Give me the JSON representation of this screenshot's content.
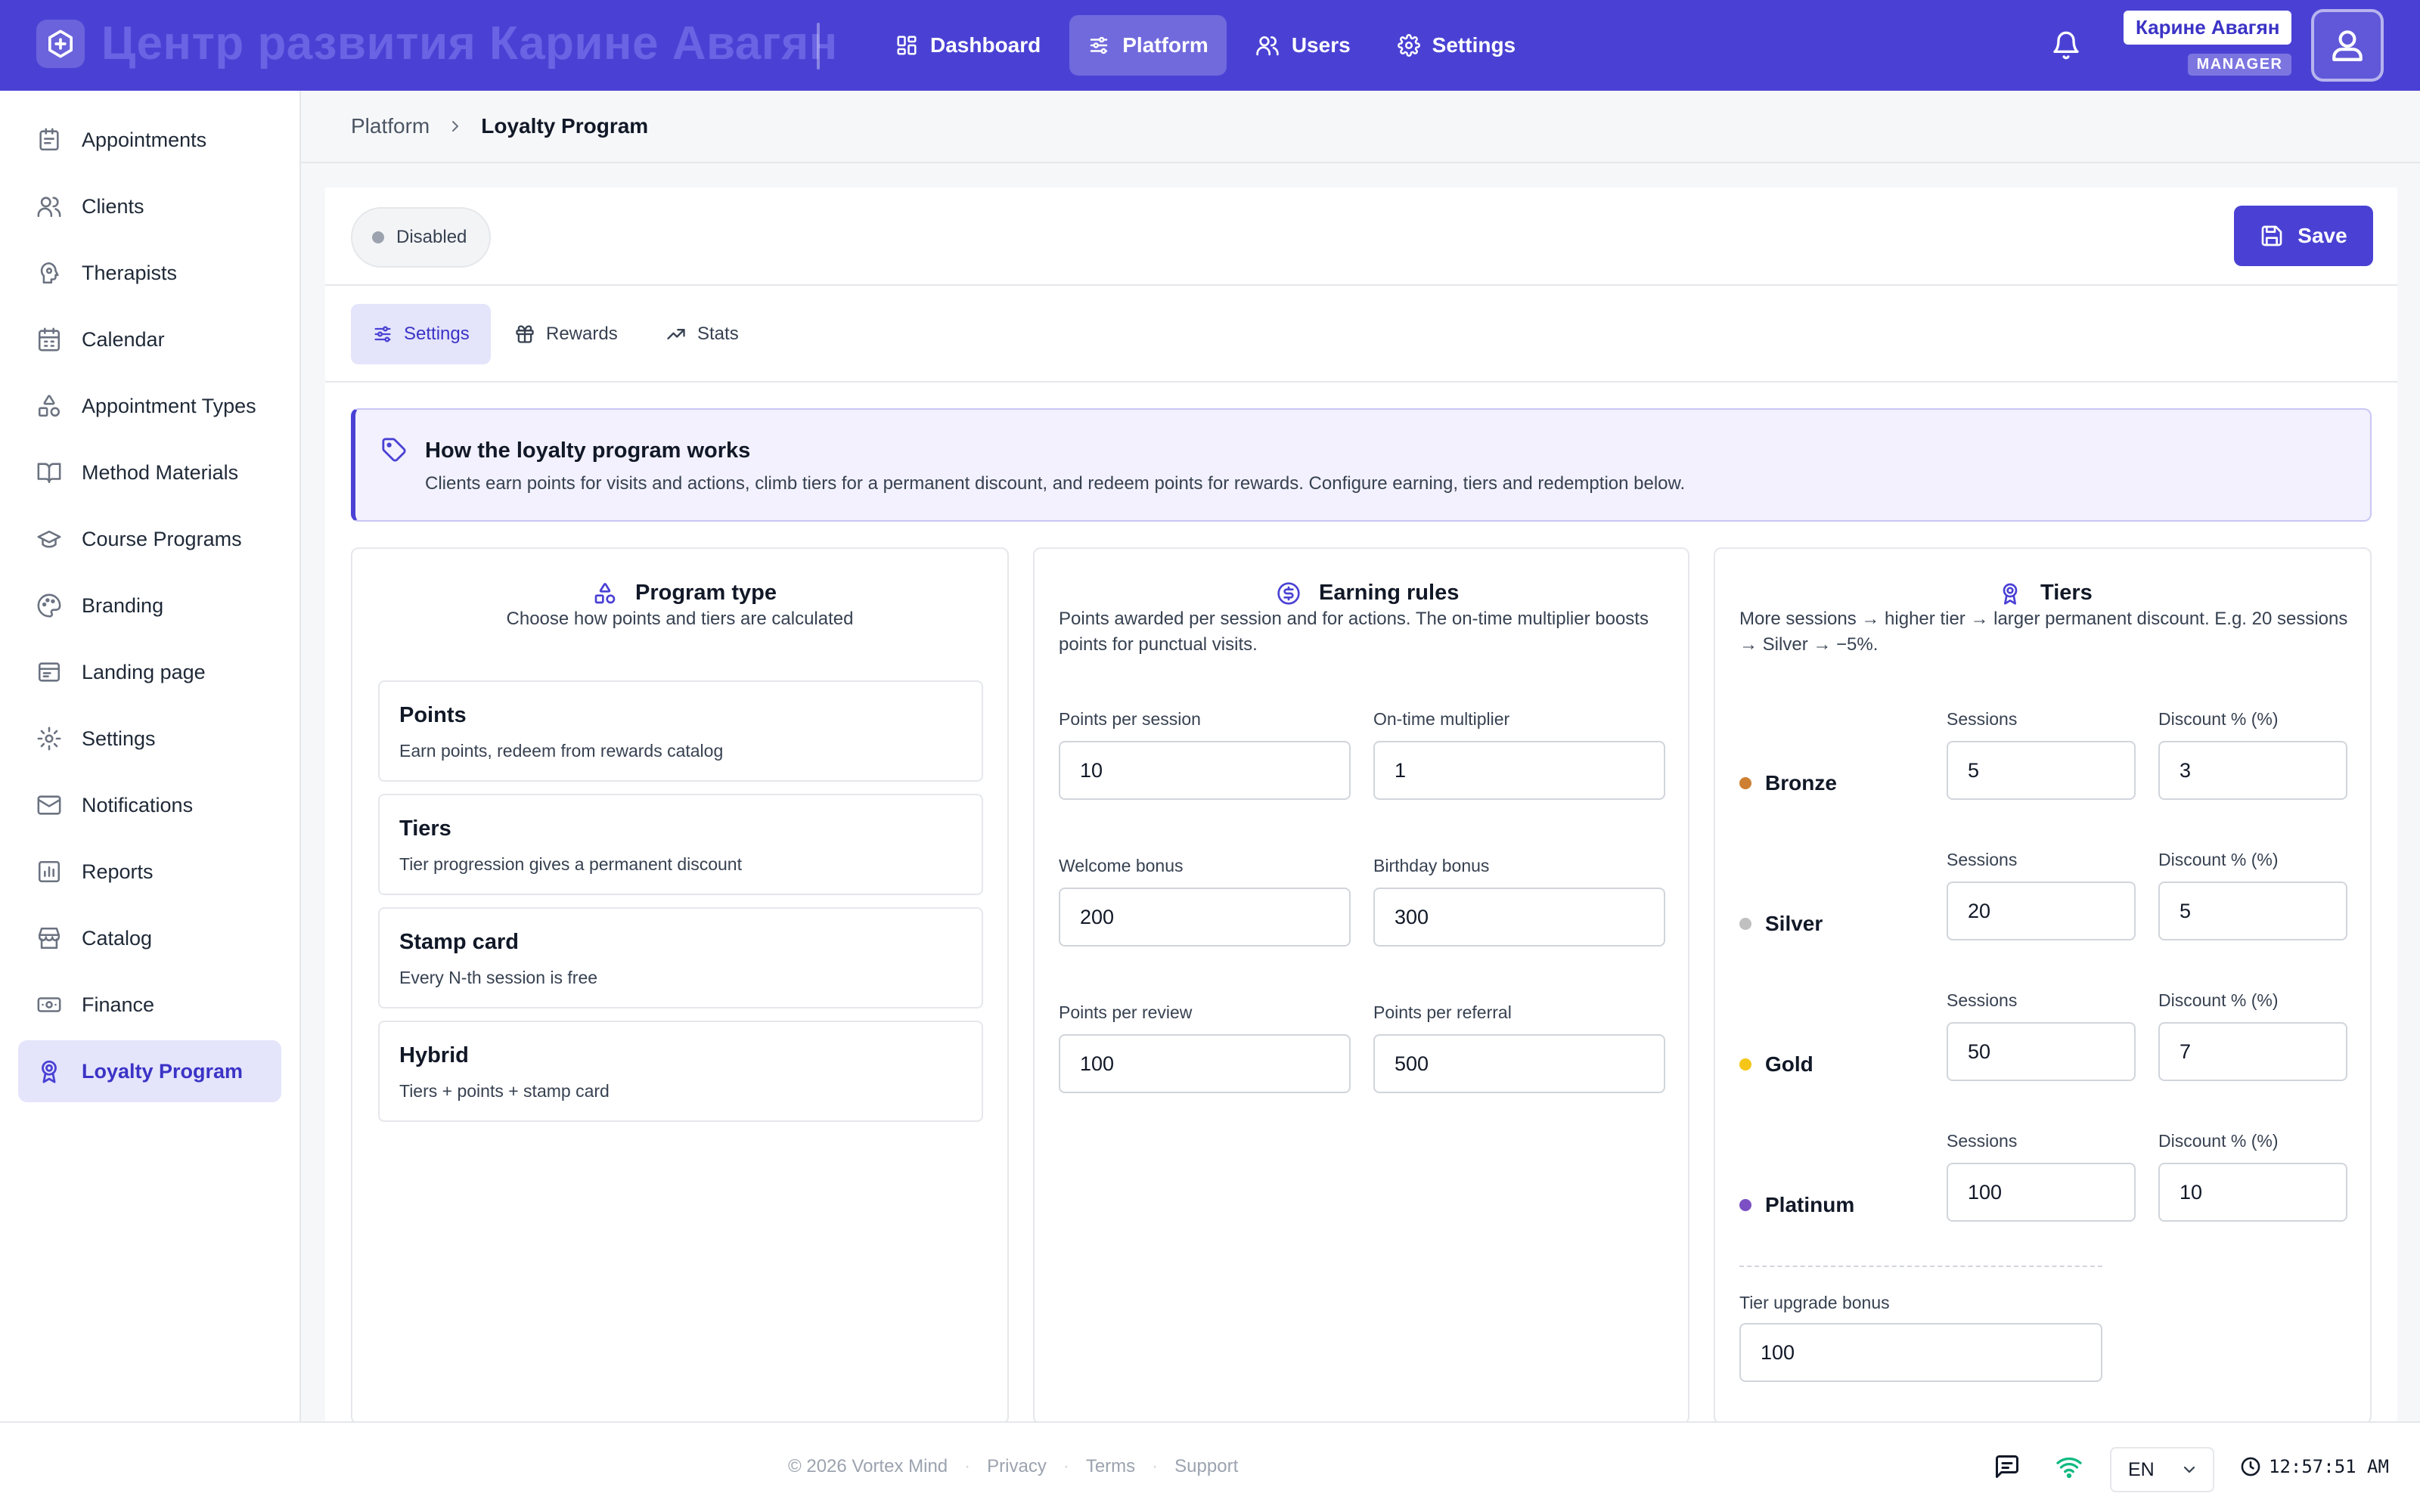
{
  "header": {
    "brand_title": "Центр развития Карине Авагян",
    "nav": [
      {
        "label": "Dashboard"
      },
      {
        "label": "Platform"
      },
      {
        "label": "Users"
      },
      {
        "label": "Settings"
      }
    ],
    "user_name": "Карине Авагян",
    "user_role": "MANAGER"
  },
  "sidebar": {
    "items": [
      {
        "label": "Appointments",
        "icon": "clipboard-icon"
      },
      {
        "label": "Clients",
        "icon": "users-icon"
      },
      {
        "label": "Therapists",
        "icon": "brain-icon"
      },
      {
        "label": "Calendar",
        "icon": "calendar-icon"
      },
      {
        "label": "Appointment Types",
        "icon": "shapes-icon"
      },
      {
        "label": "Method Materials",
        "icon": "book-open-icon"
      },
      {
        "label": "Course Programs",
        "icon": "graduation-cap-icon"
      },
      {
        "label": "Branding",
        "icon": "palette-icon"
      },
      {
        "label": "Landing page",
        "icon": "browser-icon"
      },
      {
        "label": "Settings",
        "icon": "gear-icon"
      },
      {
        "label": "Notifications",
        "icon": "mail-icon"
      },
      {
        "label": "Reports",
        "icon": "bar-chart-icon"
      },
      {
        "label": "Catalog",
        "icon": "store-icon"
      },
      {
        "label": "Finance",
        "icon": "banknote-icon"
      },
      {
        "label": "Loyalty Program",
        "icon": "award-icon"
      }
    ]
  },
  "breadcrumb": {
    "parent": "Platform",
    "current": "Loyalty Program"
  },
  "toolbar": {
    "status": "Disabled",
    "save_label": "Save"
  },
  "tabs": [
    {
      "label": "Settings"
    },
    {
      "label": "Rewards"
    },
    {
      "label": "Stats"
    }
  ],
  "info": {
    "title": "How the loyalty program works",
    "text": "Clients earn points for visits and actions, climb tiers for a permanent discount, and redeem points for rewards. Configure earning, tiers and redemption below."
  },
  "program_type": {
    "title": "Program type",
    "subtitle": "Choose how points and tiers are calculated",
    "options": [
      {
        "title": "Points",
        "desc": "Earn points, redeem from rewards catalog"
      },
      {
        "title": "Tiers",
        "desc": "Tier progression gives a permanent discount"
      },
      {
        "title": "Stamp card",
        "desc": "Every N-th session is free"
      },
      {
        "title": "Hybrid",
        "desc": "Tiers + points + stamp card"
      }
    ]
  },
  "earning": {
    "title": "Earning rules",
    "subtitle": "Points awarded per session and for actions. The on-time multiplier boosts points for punctual visits.",
    "fields": [
      {
        "label": "Points per session",
        "value": "10"
      },
      {
        "label": "On-time multiplier",
        "value": "1"
      },
      {
        "label": "Welcome bonus",
        "value": "200"
      },
      {
        "label": "Birthday bonus",
        "value": "300"
      },
      {
        "label": "Points per review",
        "value": "100"
      },
      {
        "label": "Points per referral",
        "value": "500"
      }
    ]
  },
  "tiers": {
    "title": "Tiers",
    "subtitle": "More sessions → higher tier → larger permanent discount. E.g. 20 sessions → Silver → −5%.",
    "sessions_label": "Sessions",
    "discount_label": "Discount % (%)",
    "levels": [
      {
        "name": "Bronze",
        "sessions": "5",
        "discount": "3",
        "color": "#cd7f32"
      },
      {
        "name": "Silver",
        "sessions": "20",
        "discount": "5",
        "color": "#c0c0c0"
      },
      {
        "name": "Gold",
        "sessions": "50",
        "discount": "7",
        "color": "#f5c518"
      },
      {
        "name": "Platinum",
        "sessions": "100",
        "discount": "10",
        "color": "#7c4fc4"
      }
    ],
    "upgrade_label": "Tier upgrade bonus",
    "upgrade_value": "100"
  },
  "footer": {
    "copyright": "© 2026 Vortex Mind",
    "links": [
      "Privacy",
      "Terms",
      "Support"
    ],
    "language": "EN",
    "time": "12:57:51 AM"
  },
  "colors": {
    "brand": "#4a41d4",
    "active_bg": "#e4e4fb",
    "online": "#10b981"
  }
}
